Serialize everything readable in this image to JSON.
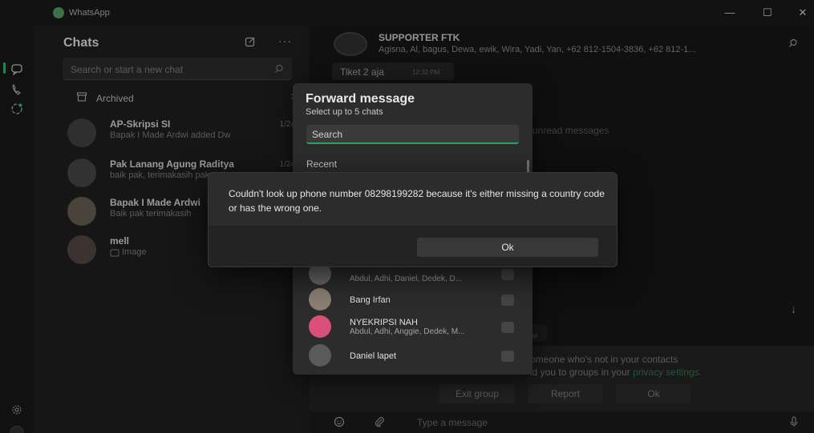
{
  "window": {
    "app_title": "WhatsApp",
    "minimize": "—",
    "maximize": "☐",
    "close": "✕"
  },
  "sidebar": {
    "title": "Chats",
    "more": "···",
    "search_placeholder": "Search or start a new chat",
    "archived": {
      "label": "Archived",
      "count": "3"
    },
    "chats": [
      {
        "name": "AP-Skripsi SI",
        "preview": "Bapak I Made Ardwi added Dw...",
        "date": "1/24"
      },
      {
        "name": "Pak Lanang Agung Raditya",
        "preview": "baik pak, terimakasih pak...",
        "date": "1/24"
      },
      {
        "name": "Bapak I Made Ardwi",
        "preview": "Baik pak terimakasih",
        "date": ""
      },
      {
        "name": "mell",
        "preview": "Image",
        "date": ""
      }
    ]
  },
  "chat": {
    "name": "SUPPORTER FTK",
    "members": "Agisna, Al, bagus, Dewa, ewik, Wira, Yadi, Yan, +62 812-1504-3836, +62 812-1...",
    "message": {
      "text": "Tiket 2 aja",
      "time": "12:32 PM"
    },
    "unread_label": "unread messages",
    "small_time": "M",
    "notice_line1": "omeone who's not in your contacts",
    "notice_line2_a": "ld you to groups in your ",
    "notice_line2_link": "privacy settings.",
    "buttons": {
      "exit": "Exit group",
      "report": "Report",
      "ok": "Ok"
    },
    "composer_placeholder": "Type a message"
  },
  "forward": {
    "title": "Forward message",
    "subtitle": "Select up to 5 chats",
    "search_placeholder": "Search",
    "recent_label": "Recent",
    "items": [
      {
        "name": "",
        "desc": "Abdul, Adhi, Daniel, Dedek, D..."
      },
      {
        "name": "Bang Irfan",
        "desc": ""
      },
      {
        "name": "NYEKRIPSI NAH",
        "desc": "Abdul, Adhi, Anggie, Dedek, M..."
      },
      {
        "name": "Daniel lapet",
        "desc": ""
      }
    ]
  },
  "alert": {
    "message": "Couldn't look up phone number 08298199282 because it's either missing a country code or has the wrong one.",
    "ok": "Ok"
  },
  "colors": {
    "accent": "#2f9f6a",
    "dialog": "#2c2c2c",
    "background": "#141414"
  }
}
